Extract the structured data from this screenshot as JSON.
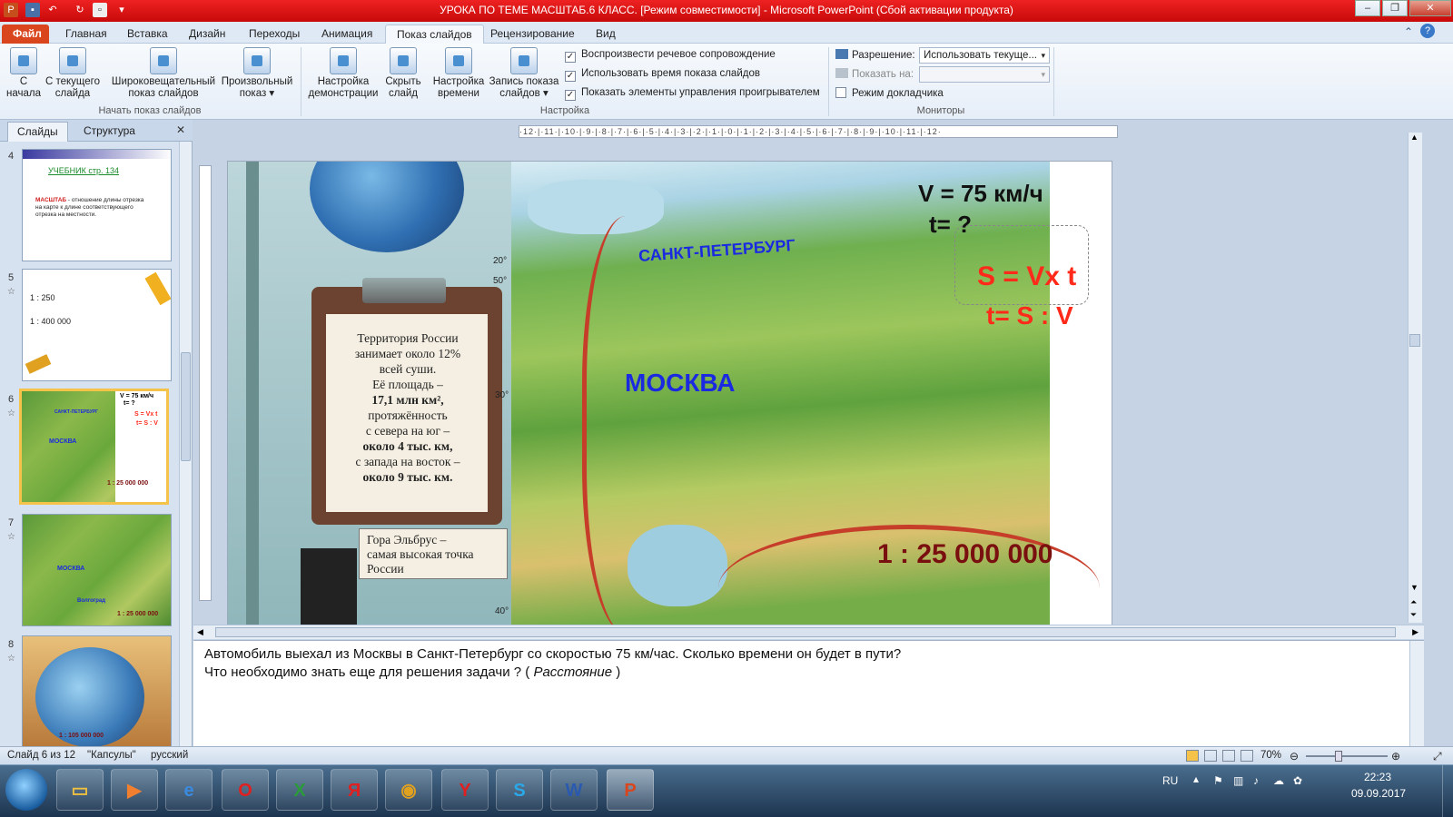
{
  "window": {
    "title": "УРОКА ПО ТЕМЕ МАСШТАБ.6 КЛАСС. [Режим совместимости] - Microsoft PowerPoint (Сбой активации продукта)"
  },
  "tabs": [
    {
      "label": "Файл"
    },
    {
      "label": "Главная"
    },
    {
      "label": "Вставка"
    },
    {
      "label": "Дизайн"
    },
    {
      "label": "Переходы"
    },
    {
      "label": "Анимация"
    },
    {
      "label": "Показ слайдов"
    },
    {
      "label": "Рецензирование"
    },
    {
      "label": "Вид"
    }
  ],
  "ribbon": {
    "from_start": "С\nначала",
    "from_current": "С текущего\nслайда",
    "broadcast": "Широковещательный\nпоказ слайдов",
    "custom": "Произвольный\nпоказ ▾",
    "group_start": "Начать показ слайдов",
    "setup": "Настройка\nдемонстрации",
    "hide": "Скрыть\nслайд",
    "rehearse": "Настройка\nвремени",
    "record": "Запись показа\nслайдов ▾",
    "chk_narration": "Воспроизвести речевое сопровождение",
    "chk_timings": "Использовать время показа слайдов",
    "chk_controls": "Показать элементы управления проигрывателем",
    "group_setup": "Настройка",
    "resolution_label": "Разрешение:",
    "resolution_value": "Использовать текуще...",
    "show_on_label": "Показать на:",
    "presenter_view": "Режим докладчика",
    "group_monitors": "Мониторы"
  },
  "left_panel": {
    "tab_slides": "Слайды",
    "tab_outline": "Структура",
    "close": "✕",
    "thumbs": [
      {
        "num": "4",
        "title": "УЧЕБНИК  стр. 134",
        "text1": "МАСШТАБ",
        "text2": " - отношение длины отрезка на карте к длине соответствующего отрезка на местности."
      },
      {
        "num": "5",
        "line1": "1 : 250",
        "line2": "1 : 400 000"
      },
      {
        "num": "6",
        "speed": "V = 75 км/ч",
        "tq": "t= ?",
        "f1": "S = Vx t",
        "f2": "t= S : V",
        "spb": "САНКТ-ПЕТЕРБУРГ",
        "msk": "МОСКВА",
        "scale": "1 : 25 000 000"
      },
      {
        "num": "7",
        "msk": "МОСКВА",
        "vol": "Волгоград",
        "scale": "1 : 25 000 000"
      },
      {
        "num": "8",
        "scale": "1 : 105 000 000"
      }
    ]
  },
  "ruler_text": "·12·|·11·|·10·|·9·|·8·|·7·|·6·|·5·|·4·|·3·|·2·|·1·|·0·|·1·|·2·|·3·|·4·|·5·|·6·|·7·|·8·|·9·|·10·|·11·|·12·",
  "slide": {
    "speed": "V = 75 км/ч",
    "t_question": "t= ?",
    "formula1": "S = Vx t",
    "formula2": "t= S : V",
    "spb": "САНКТ-ПЕТЕРБУРГ",
    "moscow": "МОСКВА",
    "scale": "1 : 25 000 000",
    "clipboard_text_1": "Территория России\nзанимает около 12%\nвсей суши.",
    "clipboard_text_2": "Её площадь –",
    "clipboard_area": "17,1 млн км²,",
    "clipboard_text_3": "протяжённость\nс севера на юг –",
    "clipboard_ns": "около 4 тыс. км,",
    "clipboard_text_4": "с запада на восток –",
    "clipboard_we": "около 9 тыс. км.",
    "elbrus": "Гора Эльбрус –\nсамая высокая точка\nРоссии",
    "lat_20": "20°",
    "lat_30": "30°",
    "lat_40": "40°",
    "lat_50": "50°"
  },
  "notes": {
    "line1": "Автомобиль выехал из Москвы в Санкт-Петербург со скоростью 75 км/час. Сколько времени  он будет в пути?",
    "line2_prefix": "Что необходимо знать еще для решения задачи ? ( ",
    "line2_italic": "Расстояние",
    "line2_suffix": " )"
  },
  "status": {
    "slide_of": "Слайд 6 из 12",
    "theme": "\"Капсулы\"",
    "lang": "русский",
    "zoom": "70%"
  },
  "taskbar": {
    "lang": "RU",
    "time": "22:23",
    "date": "09.09.2017"
  },
  "colors": {
    "title_red": "#d8141a",
    "formula_red": "#ff2a1a",
    "label_blue": "#1a2ae0",
    "scale_maroon": "#7a0f0f",
    "selected_thumb": "#f5c24a"
  }
}
